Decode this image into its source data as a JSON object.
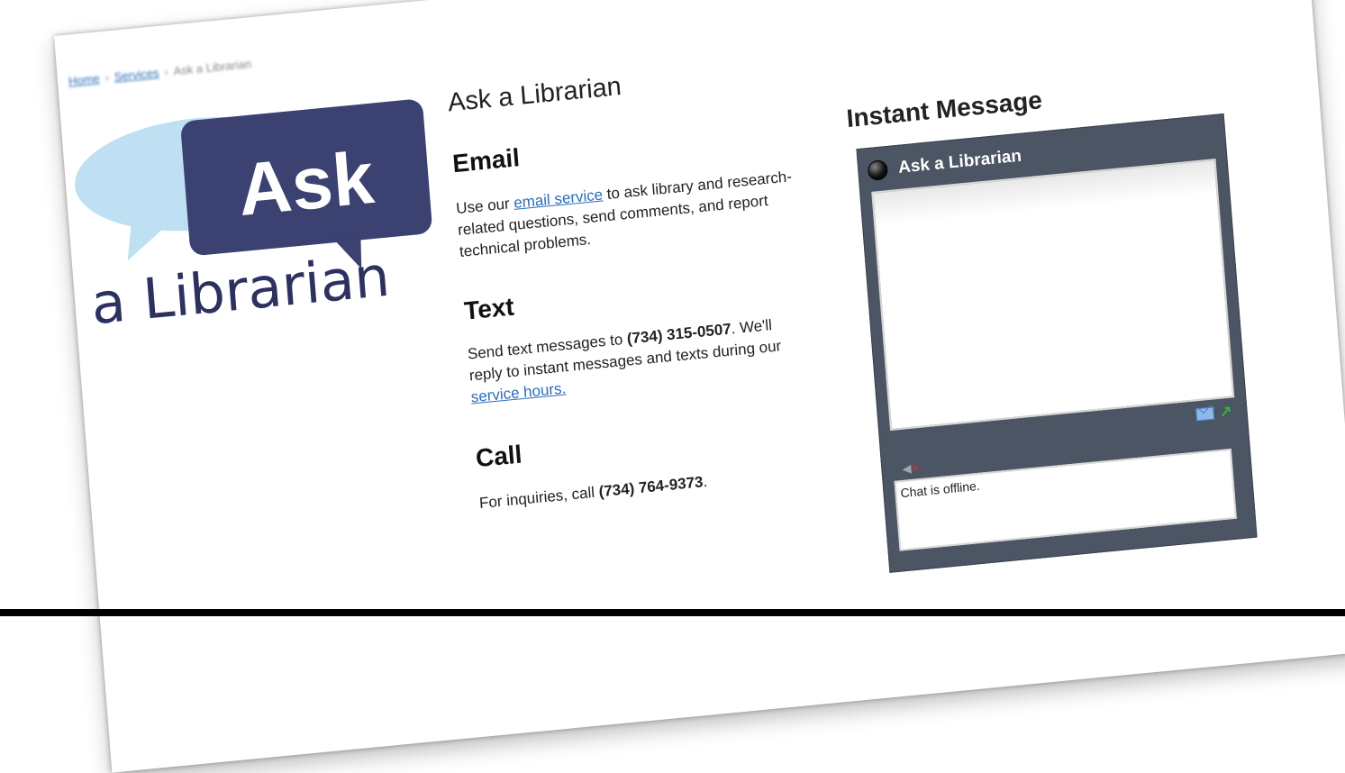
{
  "breadcrumb": {
    "items": [
      "Home",
      "Services",
      "Ask a Librarian"
    ]
  },
  "logo": {
    "top_word": "Ask",
    "bottom_word": "a Librarian",
    "colors": {
      "bubble_dark": "#3b4170",
      "bubble_light": "#bfe0f2"
    }
  },
  "page": {
    "title": "Ask a Librarian"
  },
  "email": {
    "heading": "Email",
    "before": "Use our ",
    "link": "email service",
    "after": " to ask library and research-related questions, send comments, and report technical problems."
  },
  "text": {
    "heading": "Text",
    "line1_before": "Send text messages to ",
    "phone": "(734) 315-0507",
    "line1_after": ".",
    "line2": "We'll reply to instant messages and texts during our ",
    "link": "service hours."
  },
  "call": {
    "heading": "Call",
    "before": "For inquiries, call ",
    "phone": "(734) 764-9373",
    "after": "."
  },
  "im": {
    "heading": "Instant Message",
    "widget_title": "Ask a Librarian",
    "status_text": "Chat is offline.",
    "icons": [
      "status-dot-icon",
      "mail-icon",
      "popout-icon",
      "sound-icon"
    ],
    "colors": {
      "frame": "#4b5563"
    }
  }
}
